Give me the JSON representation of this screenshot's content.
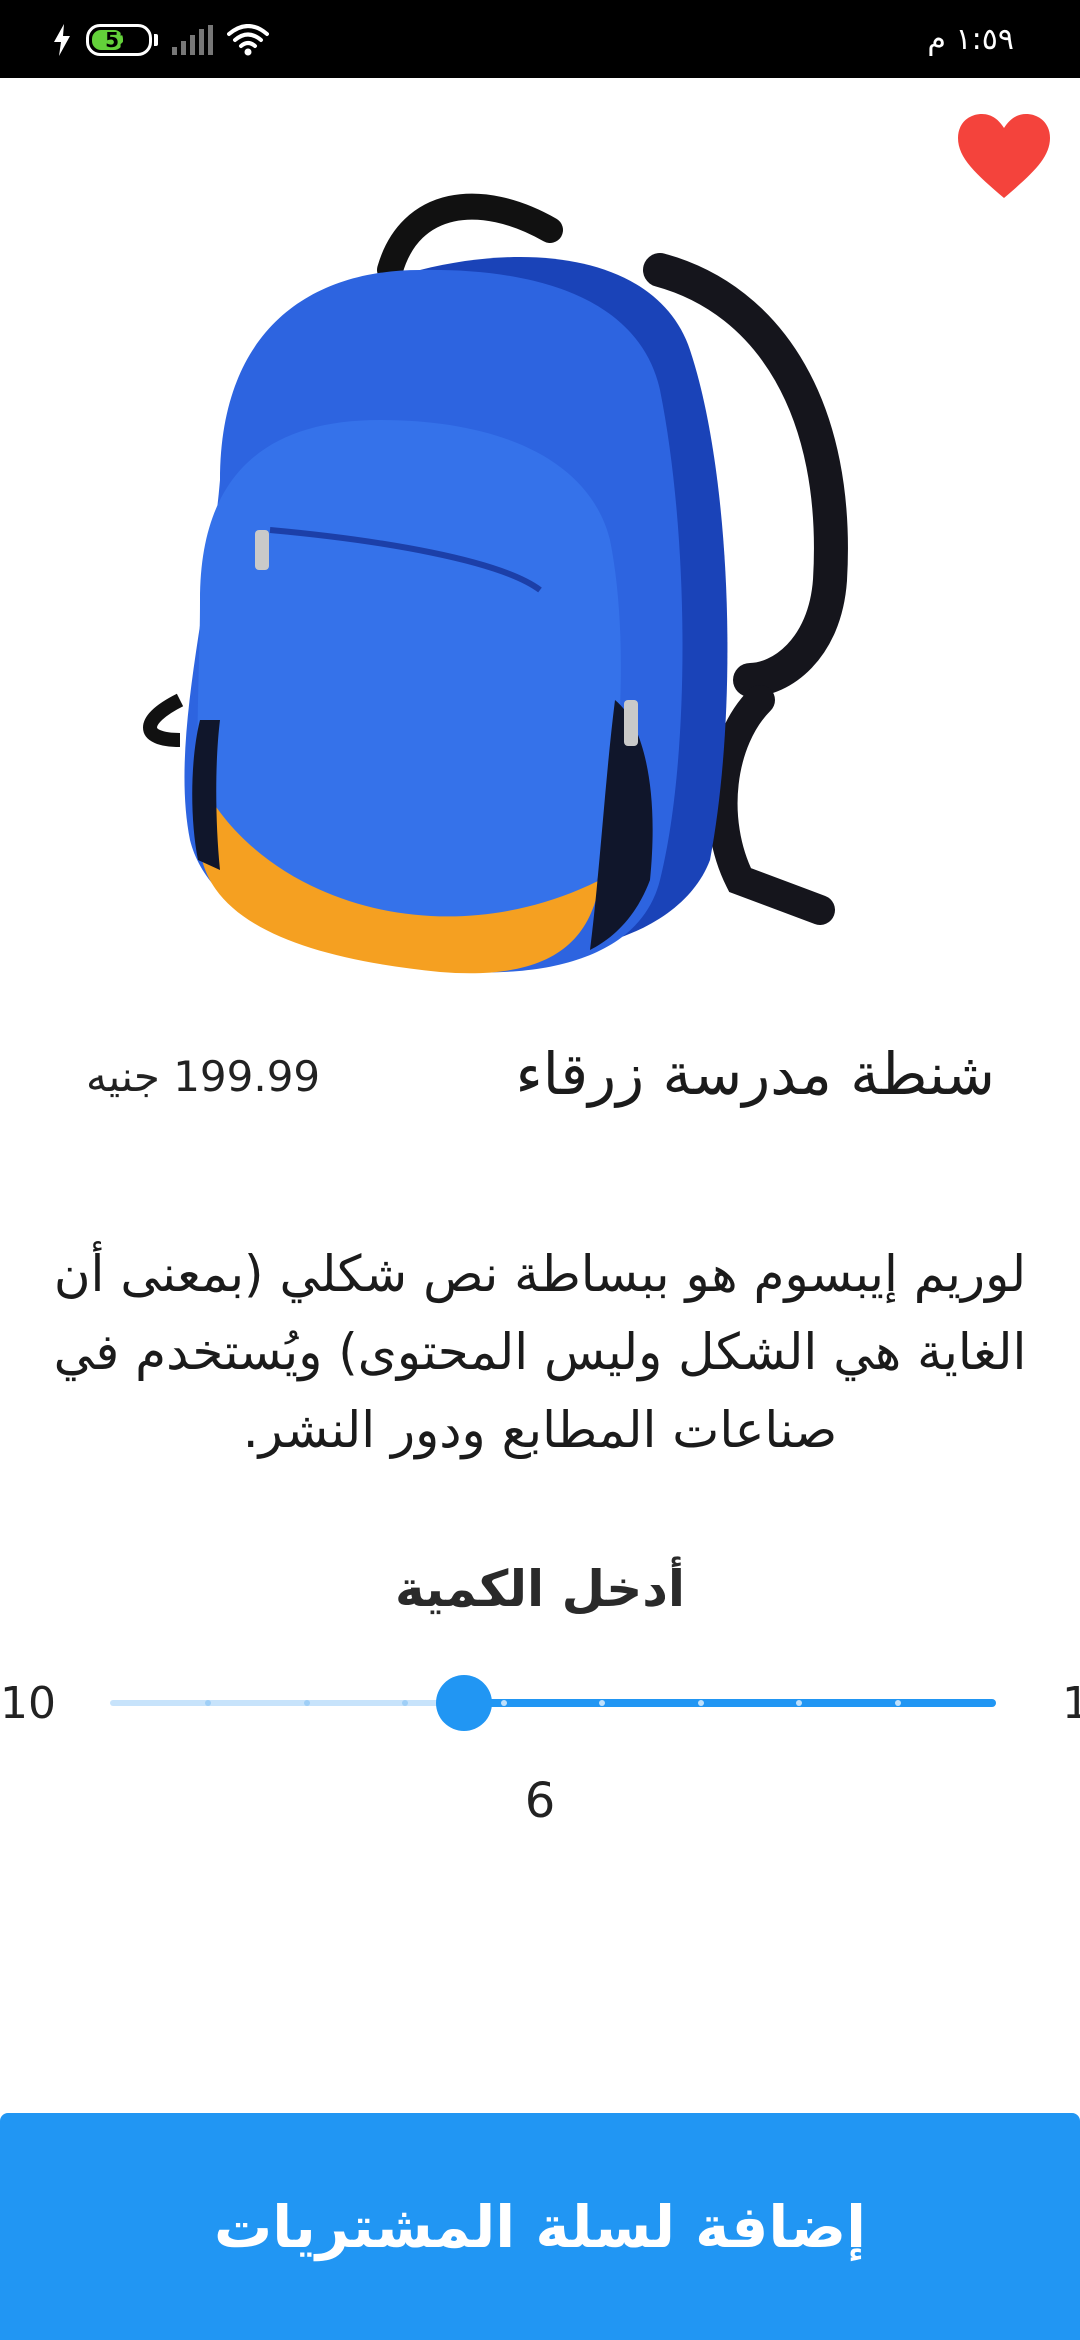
{
  "status_bar": {
    "time": "١:٥٩ م",
    "battery": "52",
    "icons": [
      "charging-bolt-icon",
      "battery-icon",
      "signal-icon",
      "wifi-icon"
    ]
  },
  "product": {
    "title": "شنطة مدرسة زرقاء",
    "price": "199.99 جنيه",
    "description": "لوريم إيبسوم هو ببساطة نص شكلي (بمعنى أن الغاية هي الشكل وليس المحتوى) ويُستخدم في صناعات المطابع ودور النشر.",
    "image_icon": "blue-backpack-image",
    "favorite_icon": "heart-icon"
  },
  "quantity": {
    "label": "أدخل الكمية",
    "min": "1",
    "max": "10",
    "value": "6",
    "fraction": 0.44
  },
  "cart_button": {
    "label": "إضافة لسلة المشتريات"
  },
  "colors": {
    "accent": "#2196f3",
    "heart": "#f4433c",
    "status_bar": "#000000"
  }
}
